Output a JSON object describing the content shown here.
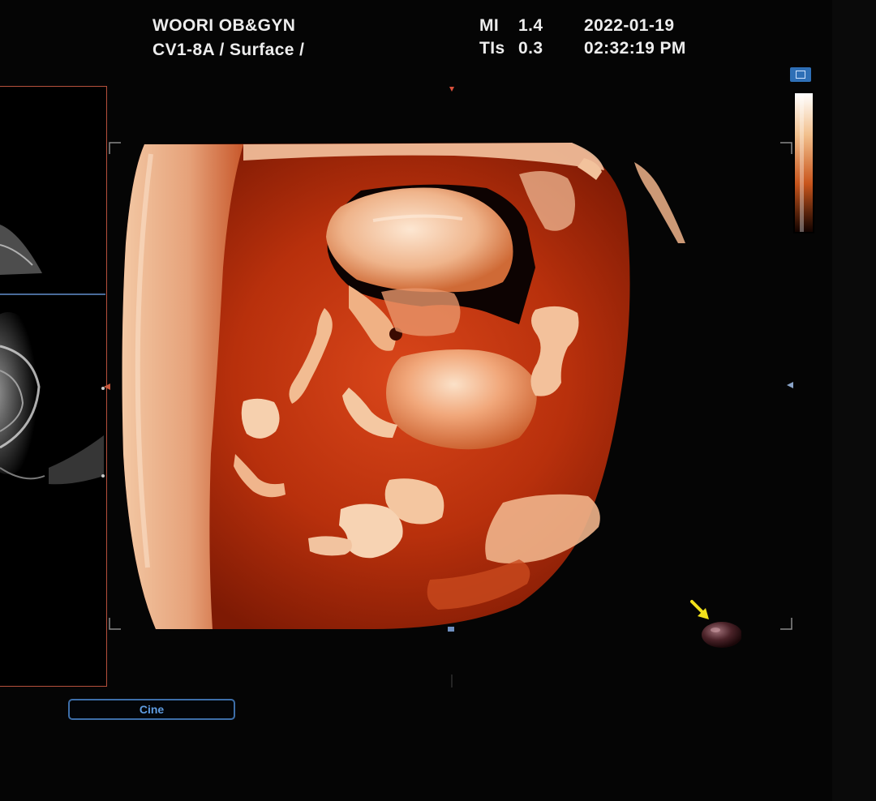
{
  "header": {
    "institution": "WOORI OB&GYN",
    "probe_info": "CV1-8A / Surface /",
    "mi_label": "MI",
    "mi_value": "1.4",
    "tis_label": "TIs",
    "tis_value": "0.3",
    "date": "2022-01-19",
    "time": "02:32:19 PM"
  },
  "controls": {
    "cine_label": "Cine"
  },
  "icons": {
    "layout": "layout-icon",
    "colorbar": "colorbar-scale",
    "orientation": "orientation-ball-icon",
    "pointer": "yellow-arrow-icon"
  },
  "colors": {
    "render_primary": "#c23a12",
    "render_highlight": "#f6c9a8",
    "panel_border": "#b5503c",
    "cine_border": "#3d6ea8",
    "arrow": "#f2e11b"
  }
}
